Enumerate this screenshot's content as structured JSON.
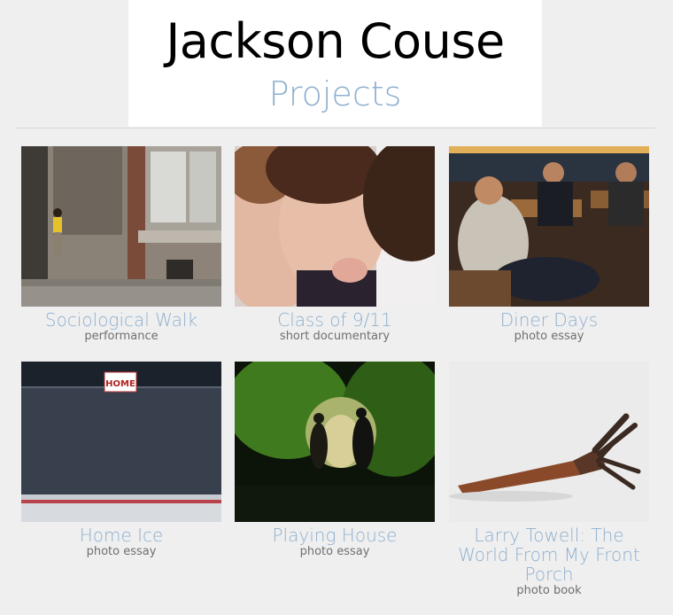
{
  "header": {
    "site_title": "Jackson Couse",
    "page_heading": "Projects"
  },
  "colors": {
    "accent": "#8fb0cf",
    "background": "#efefef",
    "subtitle": "#6f6f6f"
  },
  "projects": [
    {
      "title": "Sociological Walk",
      "category": "performance",
      "image": "storefront-boy-photo"
    },
    {
      "title": "Class of 9/11",
      "category": "short documentary",
      "image": "children-closeup-photo"
    },
    {
      "title": "Diner Days",
      "category": "photo essay",
      "image": "diner-men-photo"
    },
    {
      "title": "Home Ice",
      "category": "photo essay",
      "image": "hockey-rink-photo"
    },
    {
      "title": "Playing House",
      "category": "photo essay",
      "image": "couple-forest-photo"
    },
    {
      "title": "Larry Towell: The World From My Front Porch",
      "category": "photo book",
      "image": "rusty-tool-photo"
    }
  ],
  "sign_text": "HOME"
}
